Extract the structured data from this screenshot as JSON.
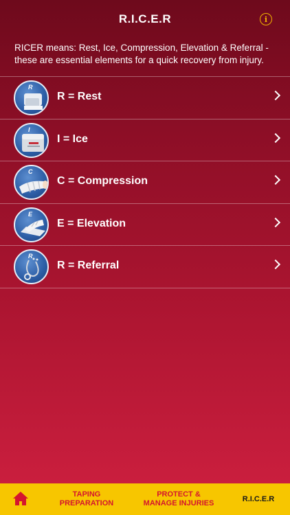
{
  "header": {
    "title": "R.I.C.E.R",
    "info_icon": "info-icon",
    "info_glyph": "i"
  },
  "intro_text": "RICER means: Rest, Ice, Compression, Elevation & Referral - these are essential elements for a quick recovery from injury.",
  "items": [
    {
      "letter": "R",
      "label": "R = Rest",
      "icon": "rest-illustration-icon"
    },
    {
      "letter": "I",
      "label": "I = Ice",
      "icon": "ice-illustration-icon"
    },
    {
      "letter": "C",
      "label": "C = Compression",
      "icon": "compression-illustration-icon"
    },
    {
      "letter": "E",
      "label": "E = Elevation",
      "icon": "elevation-illustration-icon"
    },
    {
      "letter": "R",
      "label": "R = Referral",
      "icon": "referral-illustration-icon"
    }
  ],
  "tabbar": {
    "home_icon": "home-icon",
    "tab1": "TAPING\nPREPARATION",
    "tab2": "PROTECT &\nMANAGE INJURIES",
    "tab3": "R.I.C.E.R"
  },
  "colors": {
    "accent": "#f7c600",
    "tab_text": "#d4152e",
    "info": "#f0b400"
  }
}
